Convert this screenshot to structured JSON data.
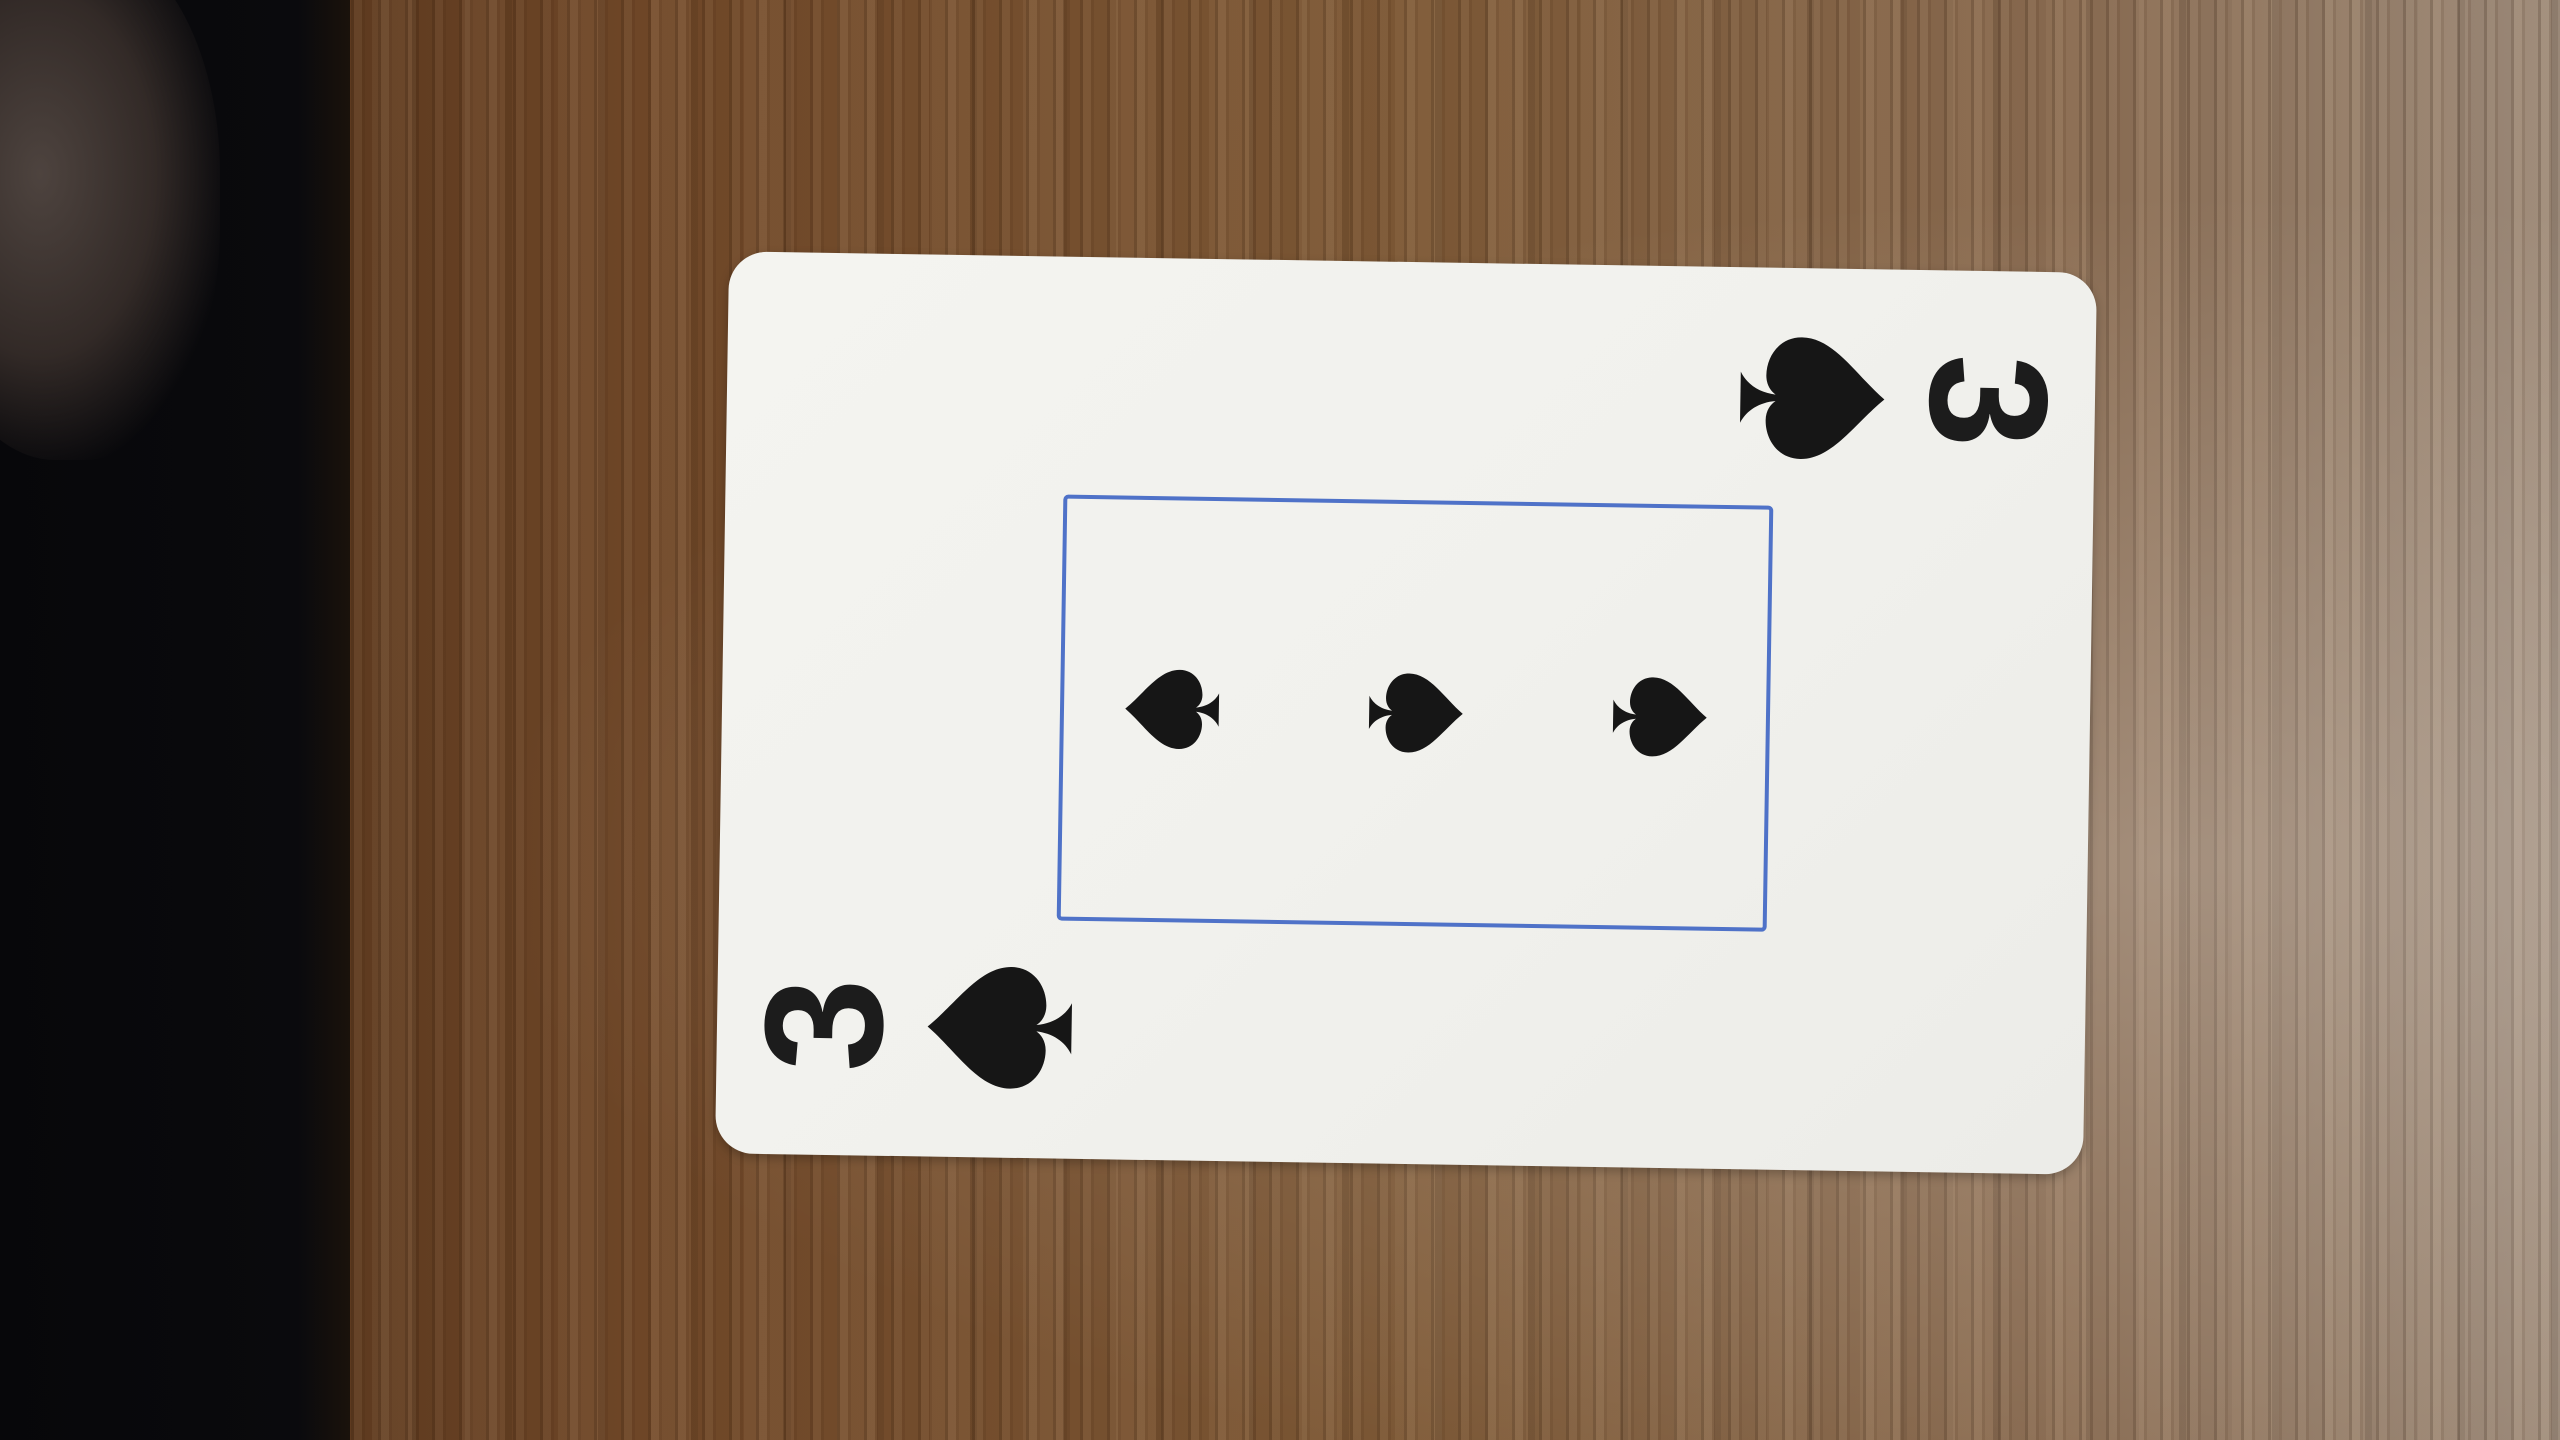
{
  "card": {
    "rank": "3",
    "suit": "spades",
    "suit_icon": "spade-icon",
    "pip_count": 3,
    "colors": {
      "face": "#f2f2ee",
      "ink": "#1b1b1b",
      "frame": "#4f72c8"
    }
  }
}
